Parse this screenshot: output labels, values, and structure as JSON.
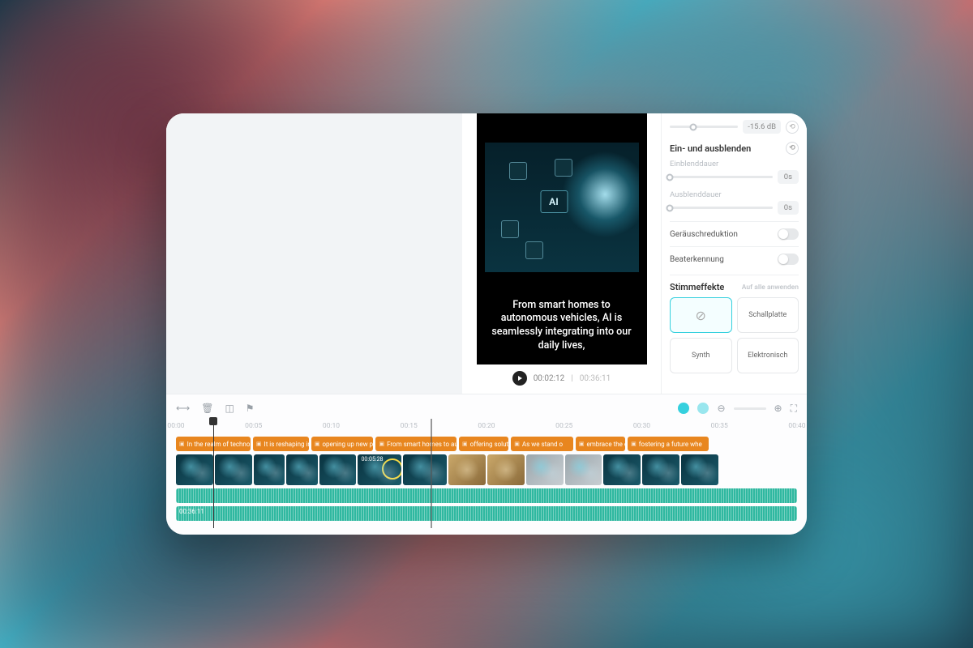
{
  "preview": {
    "ai_badge": "AI",
    "caption": "From smart homes to autonomous vehicles, AI is seamlessly integrating into our daily lives,",
    "timecode_current": "00:02:12",
    "timecode_total": "00:36:11"
  },
  "sidebar": {
    "volume_db": "-15.6 dB",
    "fade_section": "Ein- und ausblenden",
    "fade_in_label": "Einblenddauer",
    "fade_in_value": "0s",
    "fade_out_label": "Ausblenddauer",
    "fade_out_value": "0s",
    "noise_reduction": "Geräuschreduktion",
    "beat_detection": "Beaterkennung",
    "voice_fx": "Stimmeffekte",
    "voice_fx_hint": "Auf alle anwenden",
    "fx_none": "⊘",
    "fx_vinyl": "Schallplatte",
    "fx_synth": "Synth",
    "fx_electronic": "Elektronisch"
  },
  "timeline": {
    "ruler": [
      "00:00",
      "00:05",
      "00:10",
      "00:15",
      "00:20",
      "00:25",
      "00:30",
      "00:35",
      "00:40"
    ],
    "playhead_pct": 6,
    "scrub_pct": 41,
    "captions": [
      {
        "label": "In the realm of technology, t",
        "w": 12
      },
      {
        "label": "It is reshaping indus",
        "w": 9
      },
      {
        "label": "opening up new p",
        "w": 10
      },
      {
        "label": "From smart homes to auton",
        "w": 13
      },
      {
        "label": "offering solutions",
        "w": 8
      },
      {
        "label": "As we stand o",
        "w": 10
      },
      {
        "label": "embrace the op",
        "w": 8
      },
      {
        "label": "fostering a future whe",
        "w": 13
      }
    ],
    "video_clips": [
      {
        "w": 6,
        "variant": ""
      },
      {
        "w": 6,
        "variant": ""
      },
      {
        "w": 5,
        "variant": ""
      },
      {
        "w": 5,
        "variant": ""
      },
      {
        "w": 6,
        "variant": ""
      },
      {
        "w": 7,
        "variant": ""
      },
      {
        "w": 7,
        "variant": ""
      },
      {
        "w": 6,
        "variant": "warm"
      },
      {
        "w": 6,
        "variant": "warm"
      },
      {
        "w": 6,
        "variant": "light"
      },
      {
        "w": 6,
        "variant": "light"
      },
      {
        "w": 6,
        "variant": ""
      },
      {
        "w": 6,
        "variant": ""
      },
      {
        "w": 6,
        "variant": ""
      }
    ],
    "clip_timecode": "00:05:28",
    "audio2_label": "00:36:11"
  }
}
